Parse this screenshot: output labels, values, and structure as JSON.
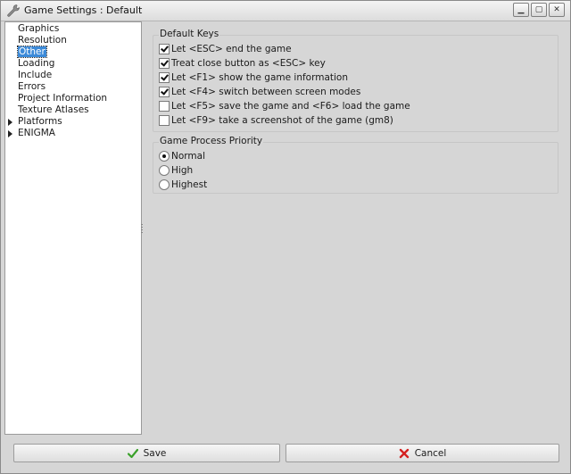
{
  "window": {
    "title": "Game Settings : Default",
    "icon": "wrench-icon",
    "controls": [
      "minimize",
      "maximize",
      "close"
    ]
  },
  "tree": {
    "items": [
      {
        "label": "Graphics",
        "expandable": false,
        "selected": false
      },
      {
        "label": "Resolution",
        "expandable": false,
        "selected": false
      },
      {
        "label": "Other",
        "expandable": false,
        "selected": true
      },
      {
        "label": "Loading",
        "expandable": false,
        "selected": false
      },
      {
        "label": "Include",
        "expandable": false,
        "selected": false
      },
      {
        "label": "Errors",
        "expandable": false,
        "selected": false
      },
      {
        "label": "Project Information",
        "expandable": false,
        "selected": false
      },
      {
        "label": "Texture Atlases",
        "expandable": false,
        "selected": false
      },
      {
        "label": "Platforms",
        "expandable": true,
        "selected": false
      },
      {
        "label": "ENIGMA",
        "expandable": true,
        "selected": false
      }
    ]
  },
  "default_keys": {
    "title": "Default Keys",
    "options": [
      {
        "label": "Let <ESC> end the game",
        "checked": true
      },
      {
        "label": "Treat close button as <ESC> key",
        "checked": true
      },
      {
        "label": "Let <F1> show the game information",
        "checked": true
      },
      {
        "label": "Let <F4> switch between screen modes",
        "checked": true
      },
      {
        "label": "Let <F5> save the game and <F6> load the game",
        "checked": false
      },
      {
        "label": "Let <F9> take a screenshot of the game (gm8)",
        "checked": false
      }
    ]
  },
  "priority": {
    "title": "Game Process Priority",
    "options": [
      {
        "label": "Normal",
        "selected": true
      },
      {
        "label": "High",
        "selected": false
      },
      {
        "label": "Highest",
        "selected": false
      }
    ]
  },
  "footer": {
    "save_label": "Save",
    "cancel_label": "Cancel"
  },
  "colors": {
    "selection": "#3c8ad8",
    "save_check": "#3aa12a",
    "cancel_x": "#d42020"
  }
}
